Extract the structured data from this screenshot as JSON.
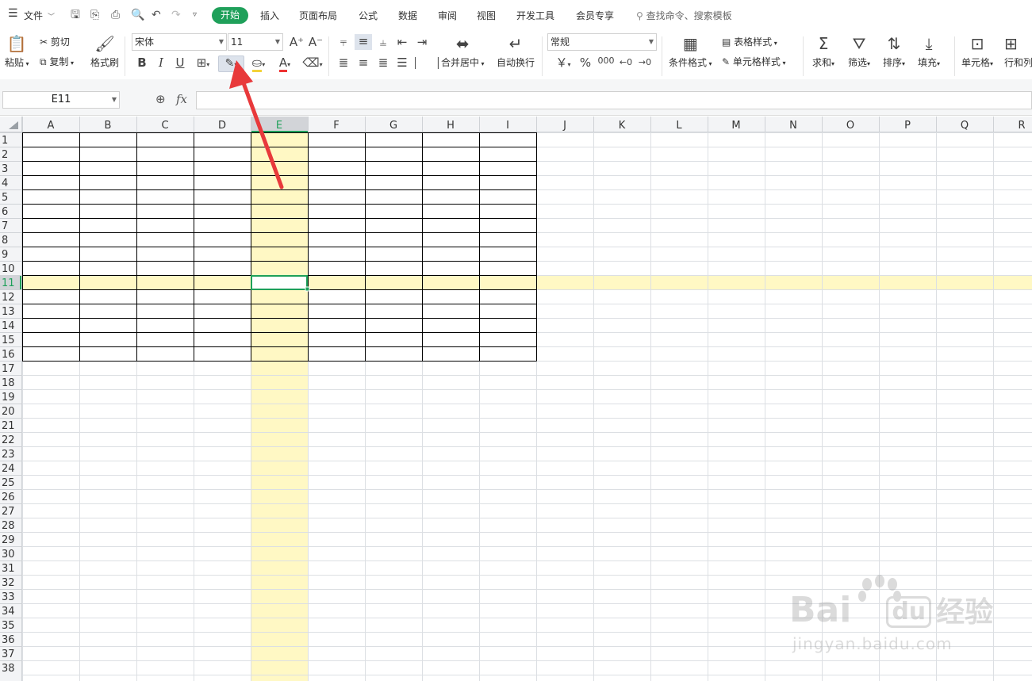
{
  "menubar": {
    "file_menu": "文件",
    "tabs": [
      "开始",
      "插入",
      "页面布局",
      "公式",
      "数据",
      "审阅",
      "视图",
      "开发工具",
      "会员专享"
    ],
    "active_tab": "开始",
    "search_placeholder": "查找命令、搜索模板"
  },
  "ribbon": {
    "paste": "粘贴",
    "cut": "剪切",
    "copy": "复制",
    "format_painter": "格式刷",
    "font_name": "宋体",
    "font_size": "11",
    "bold": "B",
    "italic": "I",
    "underline": "U",
    "font_color_letter": "A",
    "merge_center": "合并居中",
    "wrap_text": "自动换行",
    "number_format": "常规",
    "currency_symbol": "￥",
    "percent_symbol": "%",
    "thousands_symbol": "000",
    "conditional_format": "条件格式",
    "table_style": "表格样式",
    "cell_style": "单元格样式",
    "sum": "求和",
    "filter": "筛选",
    "sort": "排序",
    "fill": "填充",
    "cell": "单元格",
    "row_col": "行和列"
  },
  "formula_bar": {
    "name_box": "E11",
    "fx": "fx",
    "formula_value": ""
  },
  "sheet": {
    "columns": [
      "A",
      "B",
      "C",
      "D",
      "E",
      "F",
      "G",
      "H",
      "I",
      "J",
      "K",
      "L",
      "M",
      "N",
      "O",
      "P",
      "Q",
      "R"
    ],
    "row_count": 38,
    "active_cell": "E11",
    "active_column": "E",
    "active_row": 11,
    "bordered_range": "A1:I16"
  },
  "watermark": {
    "brand": "Bai",
    "brand_cn": "经验",
    "url": "jingyan.baidu.com"
  },
  "colors": {
    "accent": "#1fa05a",
    "highlight": "#fff8c4",
    "active_header": "#d2d4d8",
    "arrow": "#e8393b"
  }
}
